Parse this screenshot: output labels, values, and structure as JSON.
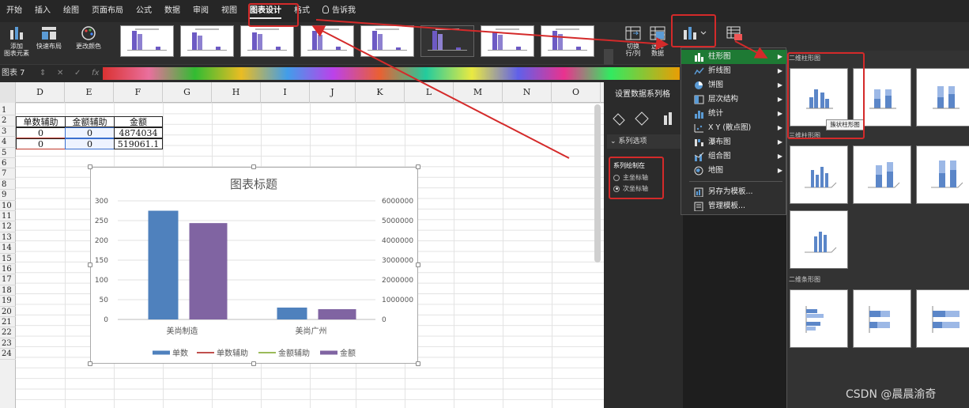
{
  "menu": [
    "开始",
    "插入",
    "绘图",
    "页面布局",
    "公式",
    "数据",
    "审阅",
    "视图",
    "图表设计",
    "格式",
    "告诉我"
  ],
  "ribbon": {
    "add_element": [
      "添加",
      "图表元素"
    ],
    "quick_layout": "快速布局",
    "change_colors": "更改颜色",
    "switch": [
      "切换",
      "行/列"
    ],
    "select_data": [
      "选择",
      "数据"
    ]
  },
  "formula_bar": {
    "name_box": "图表 7",
    "cancel": "✕",
    "confirm": "✓",
    "fx": "fx"
  },
  "columns": [
    "D",
    "E",
    "F",
    "G",
    "H",
    "I",
    "J",
    "K",
    "L",
    "M",
    "N",
    "O"
  ],
  "rows": [
    "1",
    "2",
    "3",
    "4",
    "5",
    "6",
    "7",
    "8",
    "9",
    "10",
    "11",
    "12",
    "13",
    "14",
    "15",
    "16",
    "17",
    "18",
    "19",
    "20",
    "21",
    "22",
    "23",
    "24"
  ],
  "table": {
    "headers": [
      "单数辅助",
      "金额辅助",
      "金额"
    ],
    "rows": [
      [
        "0",
        "0",
        "4874034"
      ],
      [
        "0",
        "0",
        "519061.1"
      ]
    ]
  },
  "chart_data": {
    "type": "bar",
    "title": "图表标题",
    "categories": [
      "美尚制造",
      "美尚广州"
    ],
    "series": [
      {
        "name": "单数",
        "axis": "primary",
        "values": [
          275,
          30
        ],
        "color": "#4f81bd"
      },
      {
        "name": "单数辅助",
        "axis": "primary",
        "values": [
          0,
          0
        ],
        "color": "#c0504d"
      },
      {
        "name": "金额辅助",
        "axis": "secondary",
        "values": [
          0,
          0
        ],
        "color": "#9bbb59"
      },
      {
        "name": "金额",
        "axis": "secondary",
        "values": [
          4874034,
          519061.1
        ],
        "color": "#8064a2"
      }
    ],
    "y_left": {
      "ticks": [
        "0",
        "50",
        "100",
        "150",
        "200",
        "250",
        "300"
      ],
      "range": [
        0,
        300
      ]
    },
    "y_right": {
      "ticks": [
        "0",
        "1000000",
        "2000000",
        "3000000",
        "4000000",
        "5000000",
        "6000000"
      ],
      "range": [
        0,
        6000000
      ]
    },
    "legend_position": "bottom",
    "gridlines": true
  },
  "pane": {
    "title": "设置数据系列格",
    "section": "系列选项",
    "plot_on": "系列绘制在",
    "primary": "主坐标轴",
    "secondary": "次坐标轴"
  },
  "dropdown": {
    "items": [
      "柱形图",
      "折线图",
      "饼图",
      "层次结构",
      "统计",
      "X Y (散点图)",
      "瀑布图",
      "组合图",
      "地图"
    ],
    "save_template": "另存为模板...",
    "manage_templates": "管理模板..."
  },
  "submenu": {
    "h2d": "二维柱形图",
    "h3d": "三维柱形图",
    "hbar": "二维条形图",
    "tooltip": "簇状柱形图"
  },
  "watermark": "CSDN @晨晨渝奇",
  "colors": {
    "accent_green": "#1e7a34",
    "highlight_red": "#d42a2a"
  }
}
